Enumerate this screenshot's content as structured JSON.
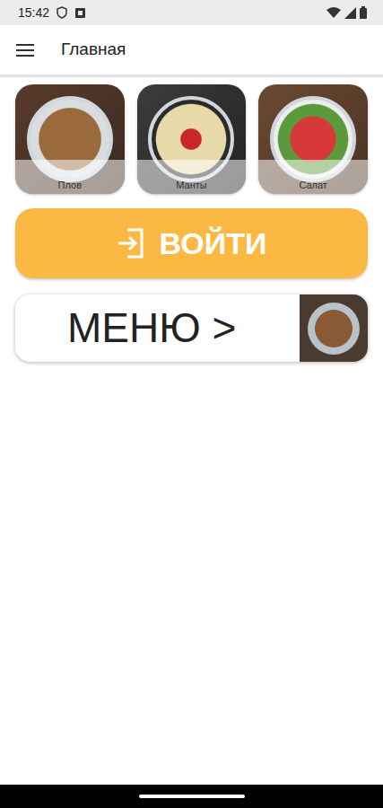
{
  "status_bar": {
    "time": "15:42"
  },
  "app_bar": {
    "title": "Главная"
  },
  "dishes": [
    {
      "label": "Плов"
    },
    {
      "label": "Манты"
    },
    {
      "label": "Салат"
    }
  ],
  "login_button": {
    "label": "ВОЙТИ"
  },
  "menu_card": {
    "label": "МЕНЮ >"
  }
}
